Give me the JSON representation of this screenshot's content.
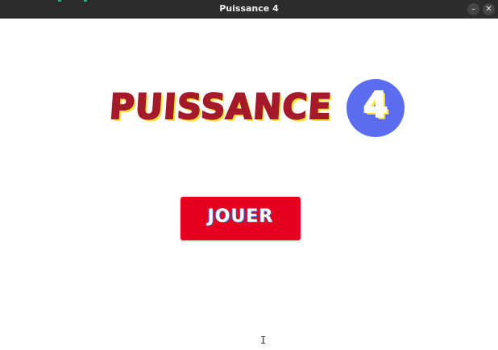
{
  "window": {
    "title": "Puissance 4",
    "minimize_glyph": "–",
    "close_glyph": "✕"
  },
  "logo": {
    "word": "PUISSANCE",
    "digit": "4",
    "colors": {
      "word": "#a51a2b",
      "shadow": "#ffe236",
      "circle": "#5b6cf0"
    }
  },
  "menu": {
    "play_label": "JOUER",
    "button_color": "#e8001f"
  },
  "cursor": {
    "glyph": "I",
    "icon": "text-cursor-icon"
  }
}
